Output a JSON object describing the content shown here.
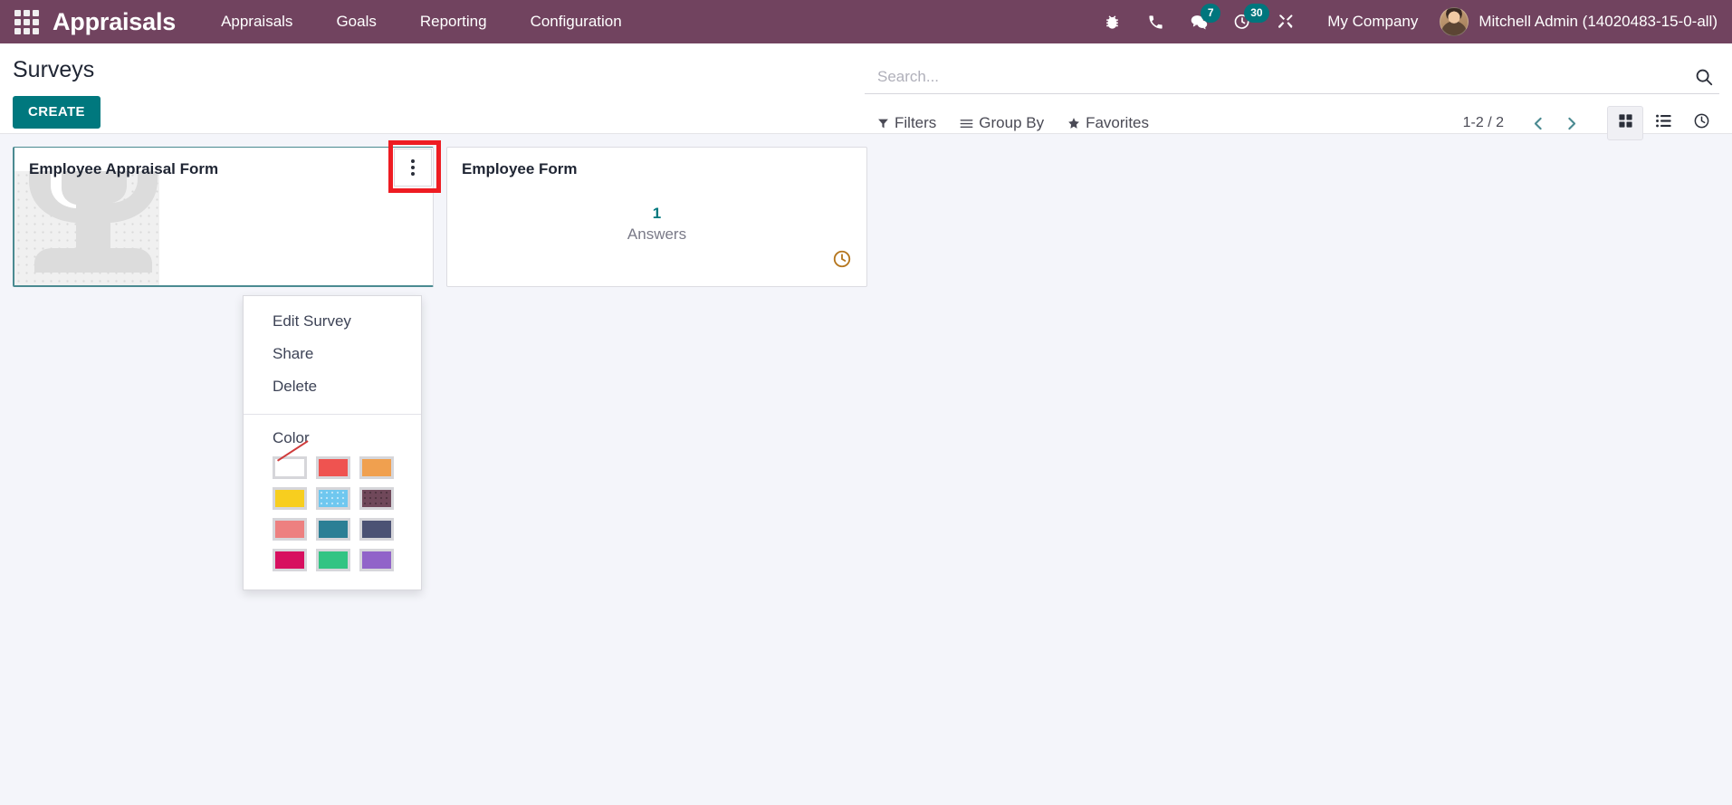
{
  "navbar": {
    "apps_icon": "grid-apps-icon",
    "brand": "Appraisals",
    "menu_items": [
      {
        "label": "Appraisals"
      },
      {
        "label": "Goals"
      },
      {
        "label": "Reporting"
      },
      {
        "label": "Configuration"
      }
    ],
    "sys_icons": [
      {
        "name": "bug-icon",
        "badge": null
      },
      {
        "name": "phone-icon",
        "badge": null
      },
      {
        "name": "messages-icon",
        "badge": "7"
      },
      {
        "name": "activity-clock-icon",
        "badge": "30"
      },
      {
        "name": "tools-icon",
        "badge": null
      }
    ],
    "company": "My Company",
    "user": "Mitchell Admin (14020483-15-0-all)",
    "bg_color": "#71435f",
    "badge_color": "#00767d"
  },
  "control_panel": {
    "title": "Surveys",
    "create_label": "CREATE",
    "create_color": "#00787e",
    "search": {
      "placeholder": "Search...",
      "value": ""
    },
    "filters": [
      {
        "label": "Filters",
        "icon": "funnel-icon"
      },
      {
        "label": "Group By",
        "icon": "bars-icon"
      },
      {
        "label": "Favorites",
        "icon": "star-icon"
      }
    ],
    "pager": "1-2 / 2",
    "views": [
      {
        "name": "kanban",
        "icon": "kanban-icon",
        "active": true
      },
      {
        "name": "list",
        "icon": "list-icon",
        "active": false
      },
      {
        "name": "activity",
        "icon": "clock-icon",
        "active": false
      }
    ]
  },
  "kanban": {
    "cards": [
      {
        "title": "Employee Appraisal Form",
        "highlighted": true,
        "has_watermark": true,
        "answers_count": null,
        "answers_label": null,
        "has_clock": false
      },
      {
        "title": "Employee Form",
        "highlighted": false,
        "has_watermark": false,
        "answers_count": "1",
        "answers_label": "Answers",
        "has_clock": true
      }
    ]
  },
  "dropdown": {
    "open": true,
    "items": [
      {
        "label": "Edit Survey"
      },
      {
        "label": "Share"
      },
      {
        "label": "Delete"
      }
    ],
    "color_section_title": "Color",
    "colors": [
      {
        "name": "No color",
        "hex": "#ffffff",
        "style": "no-color"
      },
      {
        "name": "Red",
        "hex": "#ef5350",
        "style": "plain"
      },
      {
        "name": "Orange",
        "hex": "#f0a04f",
        "style": "plain"
      },
      {
        "name": "Yellow",
        "hex": "#f7ce1f",
        "style": "plain"
      },
      {
        "name": "Light blue",
        "hex": "#6fc7ef",
        "style": "dotted"
      },
      {
        "name": "Dark purple",
        "hex": "#70485a",
        "style": "dotted-dark"
      },
      {
        "name": "Salmon pink",
        "hex": "#ed8080",
        "style": "plain"
      },
      {
        "name": "Medium blue",
        "hex": "#2b7f95",
        "style": "plain"
      },
      {
        "name": "Dark blue",
        "hex": "#4b5274",
        "style": "plain"
      },
      {
        "name": "Fuchsia",
        "hex": "#d70f5f",
        "style": "plain"
      },
      {
        "name": "Green",
        "hex": "#32c483",
        "style": "plain"
      },
      {
        "name": "Purple",
        "hex": "#9163c9",
        "style": "plain"
      }
    ]
  },
  "annotation": {
    "highlight_color": "#ee1c22",
    "target": "kanban-card-kebab-menu"
  }
}
